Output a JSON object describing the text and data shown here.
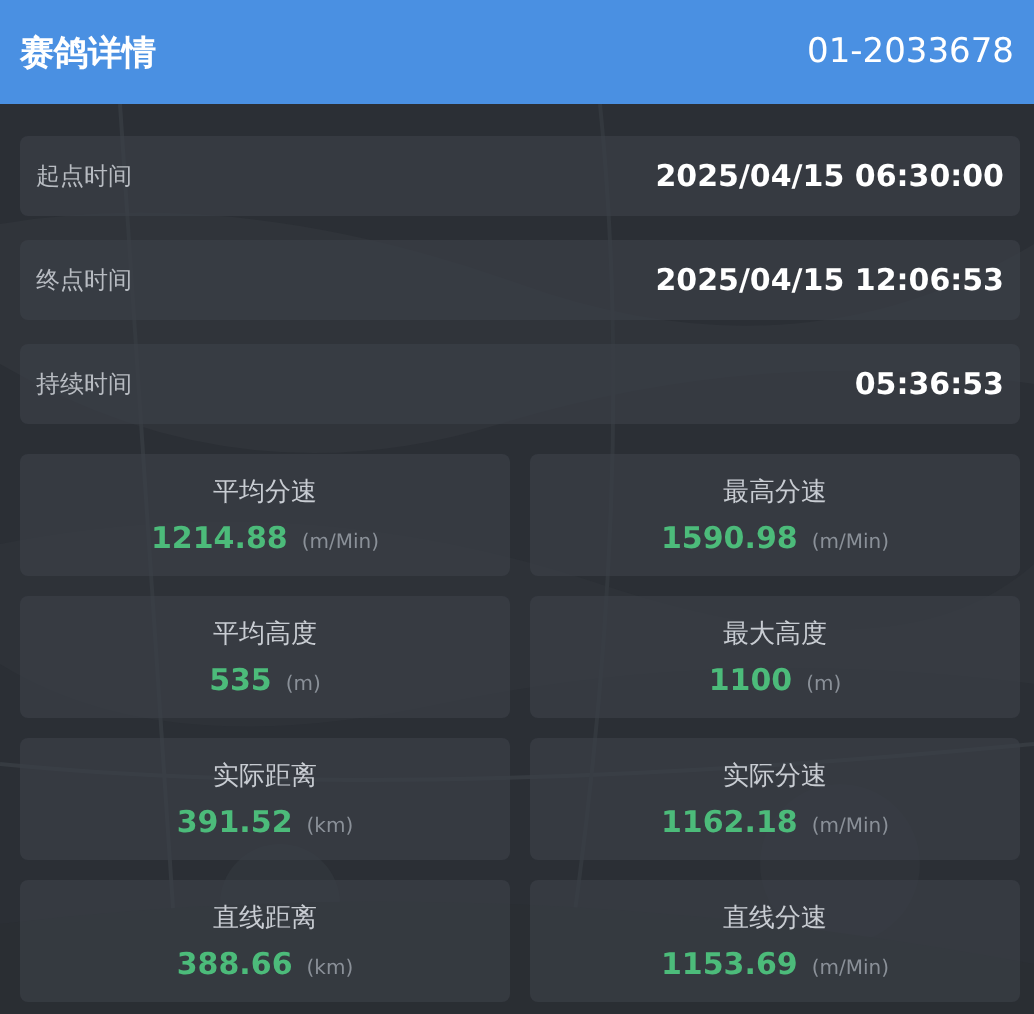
{
  "header": {
    "title": "赛鸽详情",
    "ring_number": "01-2033678"
  },
  "time_rows": [
    {
      "label": "起点时间",
      "value": "2025/04/15 06:30:00"
    },
    {
      "label": "终点时间",
      "value": "2025/04/15 12:06:53"
    },
    {
      "label": "持续时间",
      "value": "05:36:53"
    }
  ],
  "stats": [
    {
      "label": "平均分速",
      "value": "1214.88",
      "unit": "(m/Min)"
    },
    {
      "label": "最高分速",
      "value": "1590.98",
      "unit": "(m/Min)"
    },
    {
      "label": "平均高度",
      "value": "535",
      "unit": "(m)"
    },
    {
      "label": "最大高度",
      "value": "1100",
      "unit": "(m)"
    },
    {
      "label": "实际距离",
      "value": "391.52",
      "unit": "(km)"
    },
    {
      "label": "实际分速",
      "value": "1162.18",
      "unit": "(m/Min)"
    },
    {
      "label": "直线距离",
      "value": "388.66",
      "unit": "(km)"
    },
    {
      "label": "直线分速",
      "value": "1153.69",
      "unit": "(m/Min)"
    }
  ]
}
